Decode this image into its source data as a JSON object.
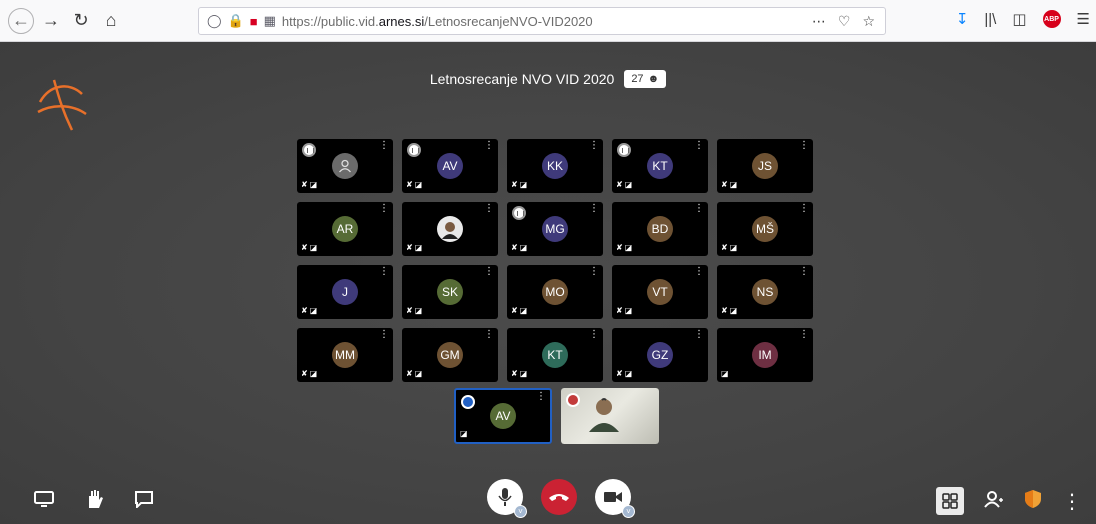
{
  "browser": {
    "url_prefix": "https://public.vid.",
    "url_domain": "arnes.si",
    "url_path": "/LetnosrecanjeNVO-VID2020",
    "abp_label": "ABP"
  },
  "meeting": {
    "title": "Letnosrecanje NVO VID 2020",
    "participant_count": "27"
  },
  "participants": [
    {
      "initials": "",
      "color": "#6b6b6b",
      "conn": true,
      "type": "generic"
    },
    {
      "initials": "AV",
      "color": "#3f3a7a",
      "conn": true
    },
    {
      "initials": "KK",
      "color": "#3f3a7a",
      "conn": false
    },
    {
      "initials": "KT",
      "color": "#3f3a7a",
      "conn": true
    },
    {
      "initials": "JS",
      "color": "#6e5233",
      "conn": false
    },
    {
      "initials": "AR",
      "color": "#566b35",
      "conn": false
    },
    {
      "initials": "",
      "color": "#ffffff",
      "conn": false,
      "type": "photo"
    },
    {
      "initials": "MG",
      "color": "#3f3a7a",
      "conn": true
    },
    {
      "initials": "BD",
      "color": "#6e5233",
      "conn": false
    },
    {
      "initials": "MŠ",
      "color": "#6e5233",
      "conn": false
    },
    {
      "initials": "J",
      "color": "#3f3a7a",
      "conn": false
    },
    {
      "initials": "SK",
      "color": "#566b35",
      "conn": false
    },
    {
      "initials": "MO",
      "color": "#6e5233",
      "conn": false
    },
    {
      "initials": "VT",
      "color": "#6e5233",
      "conn": false
    },
    {
      "initials": "NS",
      "color": "#6e5233",
      "conn": false
    },
    {
      "initials": "MM",
      "color": "#6e5233",
      "conn": false
    },
    {
      "initials": "GM",
      "color": "#6e5233",
      "conn": false
    },
    {
      "initials": "KT",
      "color": "#2e6b5a",
      "conn": false
    },
    {
      "initials": "GZ",
      "color": "#3f3a7a",
      "conn": false
    },
    {
      "initials": "IM",
      "color": "#6e2f42",
      "conn": false,
      "video_only": true
    }
  ],
  "local": {
    "dominant_initials": "AV",
    "dominant_color": "#566b35"
  },
  "colors": {
    "accent_blue": "#2160c4",
    "hangup_red": "#cb2233"
  }
}
